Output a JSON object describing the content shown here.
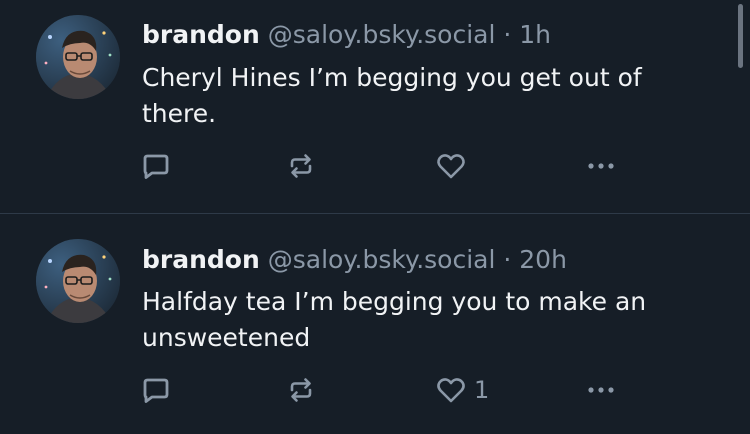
{
  "posts": [
    {
      "display_name": "brandon",
      "handle": "@saloy.bsky.social",
      "separator": "·",
      "time": "1h",
      "text": "Cheryl Hines I’m begging you get out of there.",
      "like_count": ""
    },
    {
      "display_name": "brandon",
      "handle": "@saloy.bsky.social",
      "separator": "·",
      "time": "20h",
      "text": "Halfday tea I’m begging you to make an unsweetened",
      "like_count": "1"
    }
  ],
  "icons": {
    "reply": "reply-icon",
    "repost": "repost-icon",
    "like": "heart-icon",
    "more": "more-options-icon"
  },
  "colors": {
    "background": "#161e27",
    "text": "#f1f3f5",
    "muted": "#8b98a7",
    "divider": "#2e3a48"
  }
}
